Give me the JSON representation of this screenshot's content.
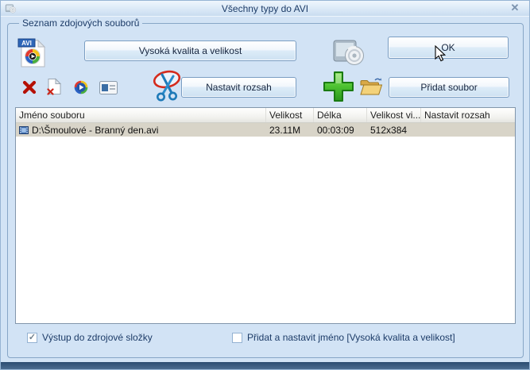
{
  "window": {
    "title": "Všechny typy do AVI"
  },
  "icons": {
    "close_glyph": "✕",
    "check_glyph": "✓"
  },
  "group_label": "Seznam zdojových souborů",
  "buttons": {
    "quality": "Vysoká kvalita a velikost",
    "ok": "OK",
    "set_range": "Nastavit rozsah",
    "add_file": "Přidat soubor"
  },
  "avi_badge": "AVI",
  "file_list": {
    "columns": [
      "Jméno souboru",
      "Velikost",
      "Délka",
      "Velikost vi...",
      "Nastavit rozsah"
    ],
    "rows": [
      {
        "name": "D:\\Šmoulové - Branný den.avi",
        "size": "23.11M",
        "length": "00:03:09",
        "video_size": "512x384",
        "range": ""
      }
    ]
  },
  "checkboxes": [
    {
      "label": "Výstup do zdrojové složky",
      "checked": true
    },
    {
      "label": "Přidat a nastavit jméno [Vysoká kvalita a velikost]",
      "checked": false
    }
  ],
  "colors": {
    "dialog_bg": "#d2e3f5",
    "button_border": "#7a9dc2",
    "selected_row": "#d8d4c8",
    "bottom_band": "#2c4c71",
    "label_text": "#1d3c68"
  }
}
